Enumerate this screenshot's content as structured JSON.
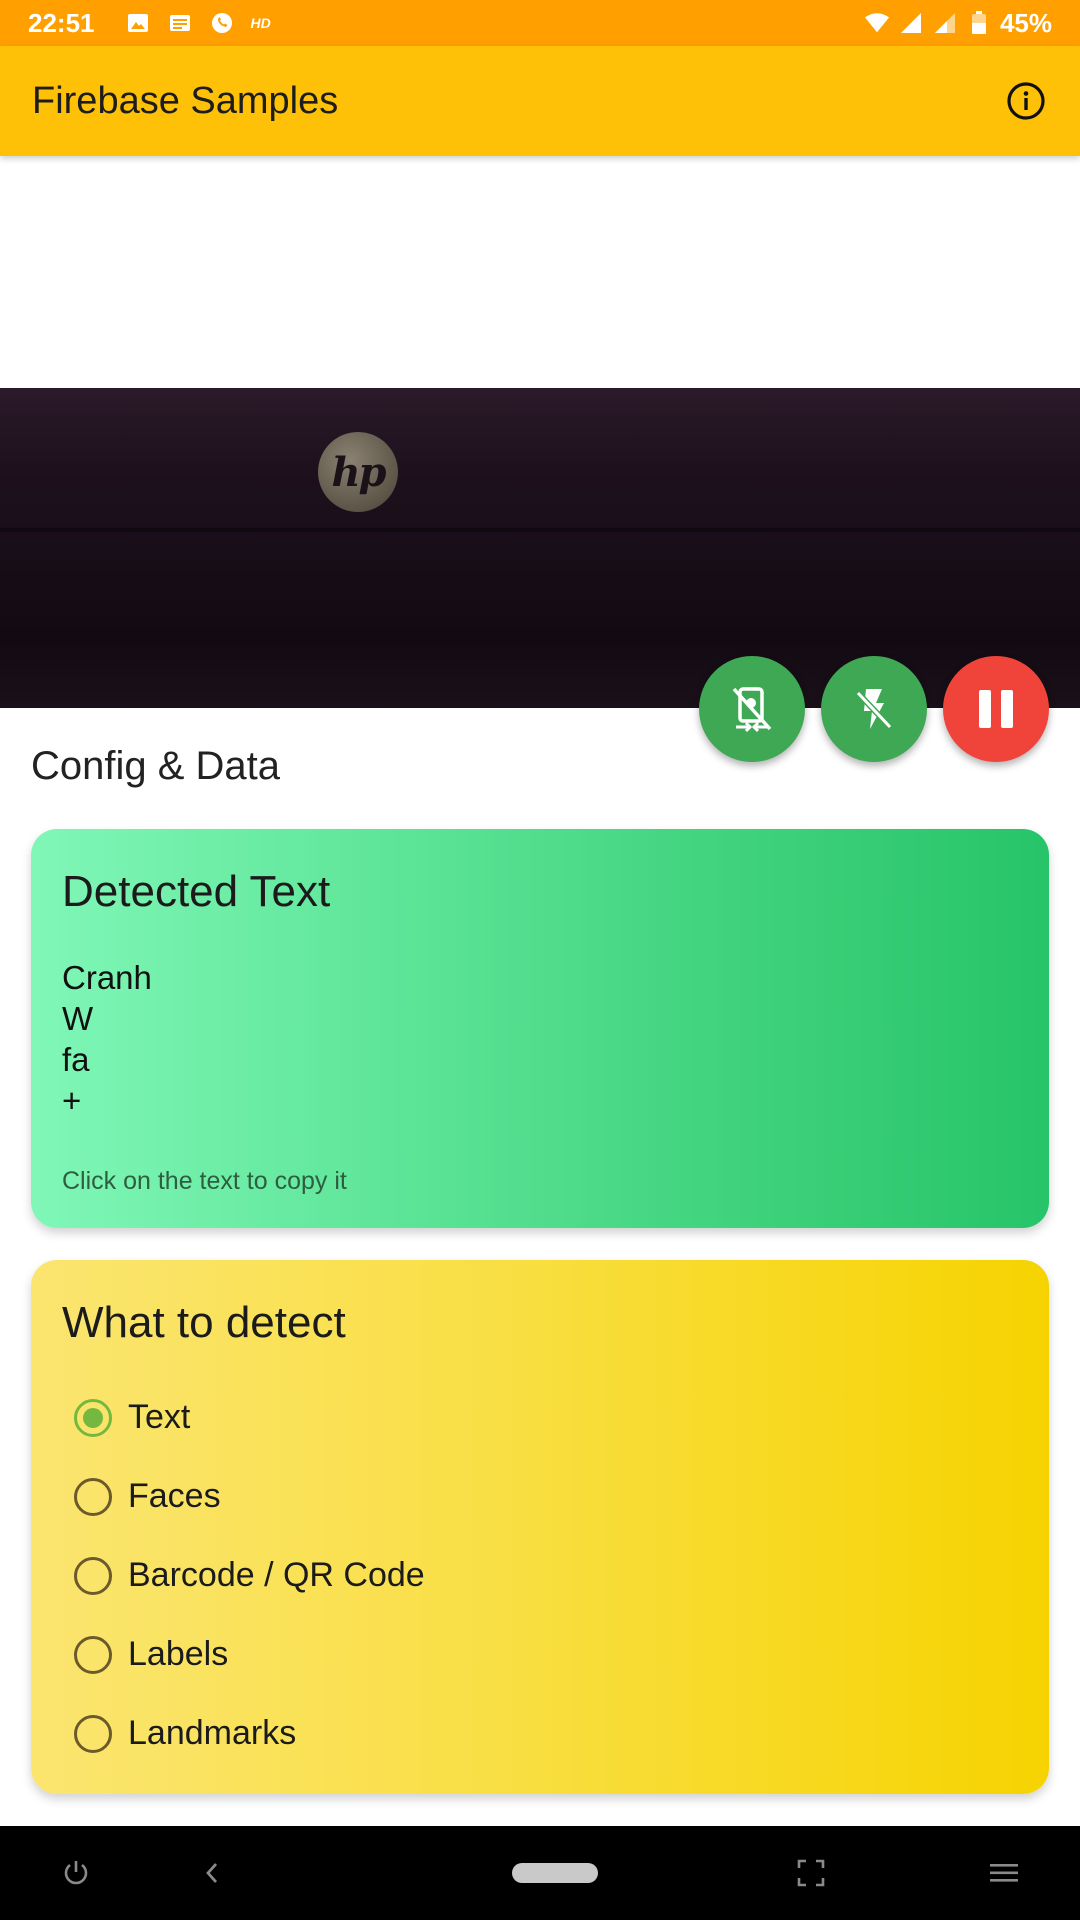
{
  "status_bar": {
    "time": "22:51",
    "hd": "HD",
    "battery": "45%",
    "icons": [
      "image-icon",
      "news-icon",
      "whatsapp-icon",
      "wifi-icon",
      "signal-icon",
      "signal-icon",
      "battery-icon"
    ]
  },
  "app_bar": {
    "title": "Firebase Samples",
    "info_icon": "info-icon"
  },
  "camera": {
    "logo_text": "hp"
  },
  "fabs": [
    {
      "name": "switch-camera",
      "icon": "camera-switch-off-icon",
      "color": "#3FA854"
    },
    {
      "name": "flash",
      "icon": "flash-off-icon",
      "color": "#3FA854"
    },
    {
      "name": "pause",
      "icon": "pause-icon",
      "color": "#F0443A"
    }
  ],
  "section_title": "Config & Data",
  "detected_card": {
    "title": "Detected Text",
    "lines": [
      "Cranh",
      "W",
      "fa",
      "+"
    ],
    "hint": "Click on the text to copy it"
  },
  "detect_card": {
    "title": "What to detect",
    "selected": "Text",
    "options": [
      "Text",
      "Faces",
      "Barcode / QR Code",
      "Labels",
      "Landmarks"
    ]
  },
  "nav_bar": {
    "icons": [
      "power-icon",
      "back-icon",
      "home-pill-icon",
      "screenshot-icon",
      "menu-icon"
    ]
  },
  "colors": {
    "status_bar": "#FF9F00",
    "app_bar": "#FFC107",
    "green_card": "#3FD27C",
    "yellow_card": "#F9DF45",
    "radio_checked": "#74B83F"
  }
}
